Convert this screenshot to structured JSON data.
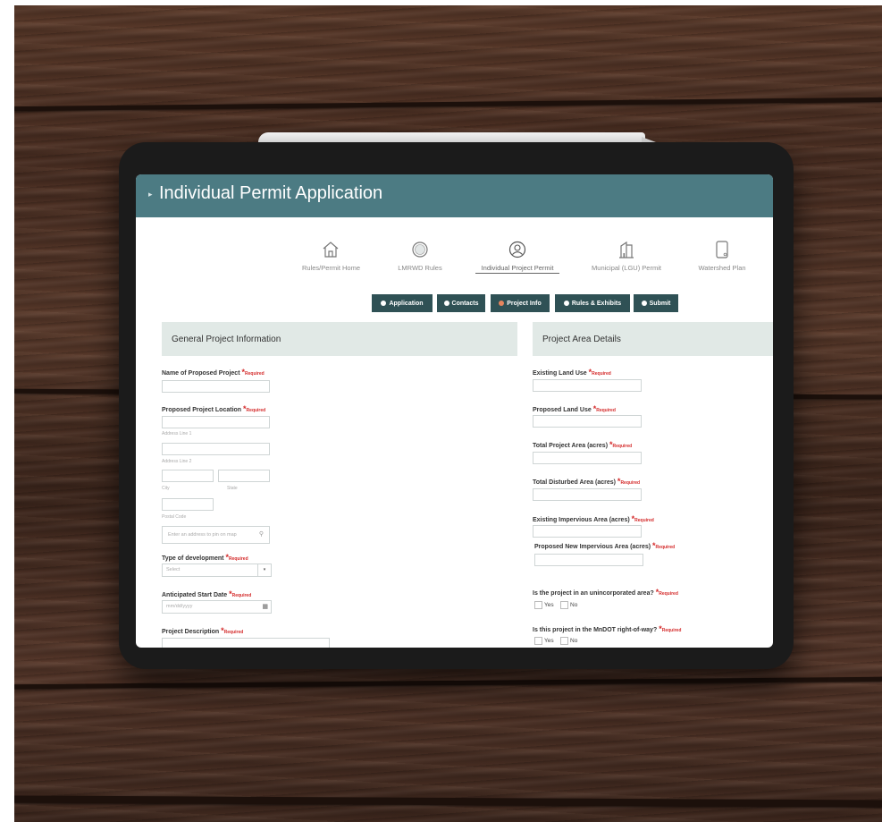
{
  "page": {
    "title": "Individual Permit Application"
  },
  "nav": [
    {
      "label": "Rules/Permit Home",
      "icon": "home-icon"
    },
    {
      "label": "LMRWD Rules",
      "icon": "badge-icon"
    },
    {
      "label": "Individual Project Permit",
      "icon": "user-icon"
    },
    {
      "label": "Municipal (LGU) Permit",
      "icon": "building-icon"
    },
    {
      "label": "Watershed Plan",
      "icon": "document-icon"
    }
  ],
  "steps": [
    {
      "label": "Application"
    },
    {
      "label": "Contacts"
    },
    {
      "label": "Project Info"
    },
    {
      "label": "Rules & Exhibits"
    },
    {
      "label": "Submit"
    }
  ],
  "required_label": "Required",
  "left_section": {
    "title": "General Project Information",
    "name_label": "Name of Proposed Project",
    "location_label": "Proposed Project Location",
    "address_line1": "Address Line 1",
    "address_line2": "Address Line 2",
    "city": "City",
    "state": "State",
    "postal": "Postal Code",
    "map_placeholder": "Enter an address to pin on map",
    "type_label": "Type of development",
    "type_value": "Select",
    "start_label": "Anticipated Start Date",
    "start_placeholder": "mm/dd/yyyy",
    "desc_label": "Project Description"
  },
  "right_section": {
    "title": "Project Area Details",
    "existing_land": "Existing Land Use",
    "proposed_land": "Proposed Land Use",
    "total_area": "Total Project Area (acres)",
    "disturbed_area": "Total Disturbed Area (acres)",
    "existing_impervious": "Existing Impervious Area (acres)",
    "new_impervious": "Proposed New Impervious Area (acres)",
    "unincorporated_q": "Is the project in an unincorporated area?",
    "mndot_q": "Is this project in the MnDOT right-of-way?",
    "yes": "Yes",
    "no": "No"
  },
  "colors": {
    "header": "#4c7b83",
    "button": "#2f5155",
    "section": "#e1e9e6",
    "required": "#d42a2a"
  }
}
